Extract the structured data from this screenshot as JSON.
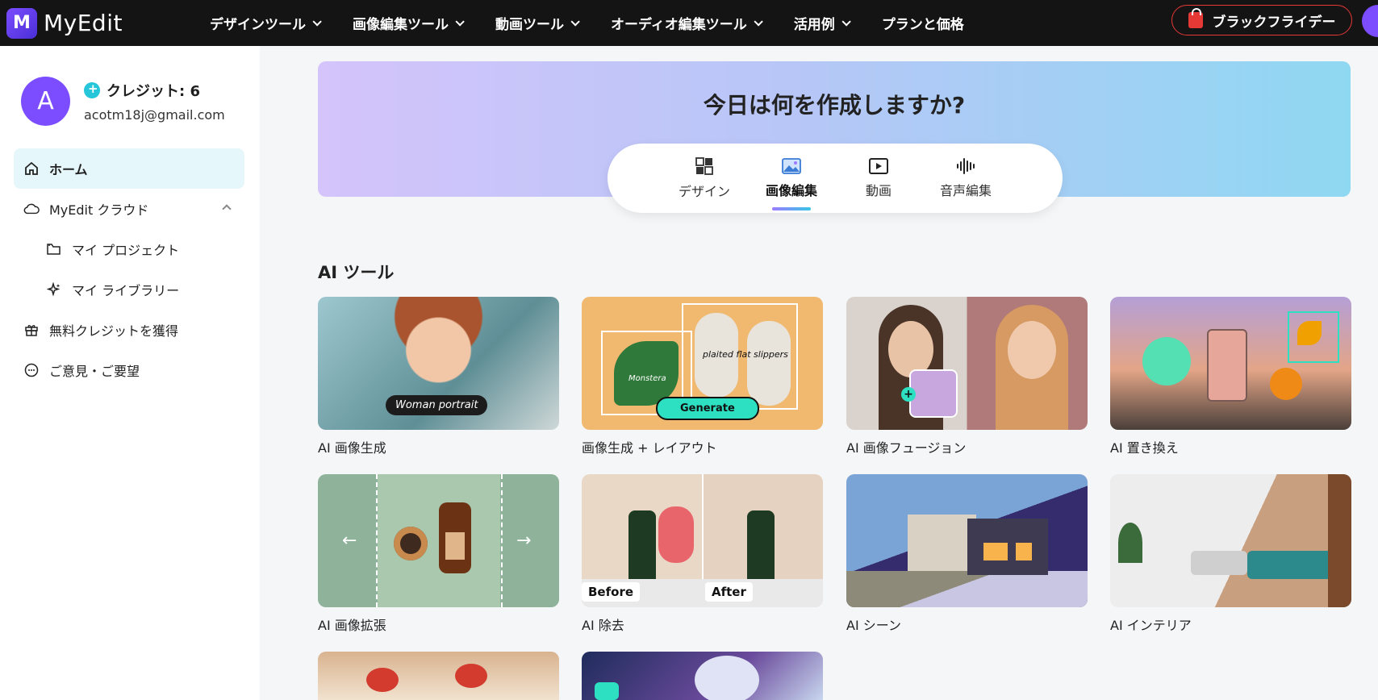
{
  "header": {
    "logo_text": "MyEdit",
    "nav": [
      {
        "label": "デザインツール"
      },
      {
        "label": "画像編集ツール"
      },
      {
        "label": "動画ツール"
      },
      {
        "label": "オーディオ編集ツール"
      },
      {
        "label": "活用例"
      },
      {
        "label": "プランと価格"
      }
    ],
    "black_friday_label": "ブラックフライデー"
  },
  "sidebar": {
    "avatar_letter": "A",
    "credits": "クレジット: 6",
    "email": "acotm18j@gmail.com",
    "items": [
      {
        "label": "ホーム"
      },
      {
        "label": "MyEdit クラウド"
      },
      {
        "label": "マイ プロジェクト"
      },
      {
        "label": "マイ ライブラリー"
      },
      {
        "label": "無料クレジットを獲得"
      },
      {
        "label": "ご意見・ご要望"
      }
    ]
  },
  "hero": {
    "title": "今日は何を作成しますか?",
    "tabs": [
      {
        "label": "デザイン"
      },
      {
        "label": "画像編集"
      },
      {
        "label": "動画"
      },
      {
        "label": "音声編集"
      }
    ],
    "active_tab": "画像編集"
  },
  "ai_tools": {
    "title": "AI ツール",
    "cards": [
      {
        "label": "AI 画像生成",
        "overlay": "Woman portrait"
      },
      {
        "label": "画像生成 + レイアウト",
        "overlay": "Generate",
        "overlay2": "plaited flat slippers",
        "overlay3": "Monstera"
      },
      {
        "label": "AI 画像フュージョン"
      },
      {
        "label": "AI 置き換え"
      },
      {
        "label": "AI 画像拡張"
      },
      {
        "label": "AI 除去",
        "before": "Before",
        "after": "After"
      },
      {
        "label": "AI シーン"
      },
      {
        "label": "AI インテリア"
      }
    ]
  },
  "colors": {
    "accent": "#7b4dff",
    "nav_bg": "#141414",
    "black_friday_border": "#e53935",
    "active_bg": "#e6f7fb"
  }
}
